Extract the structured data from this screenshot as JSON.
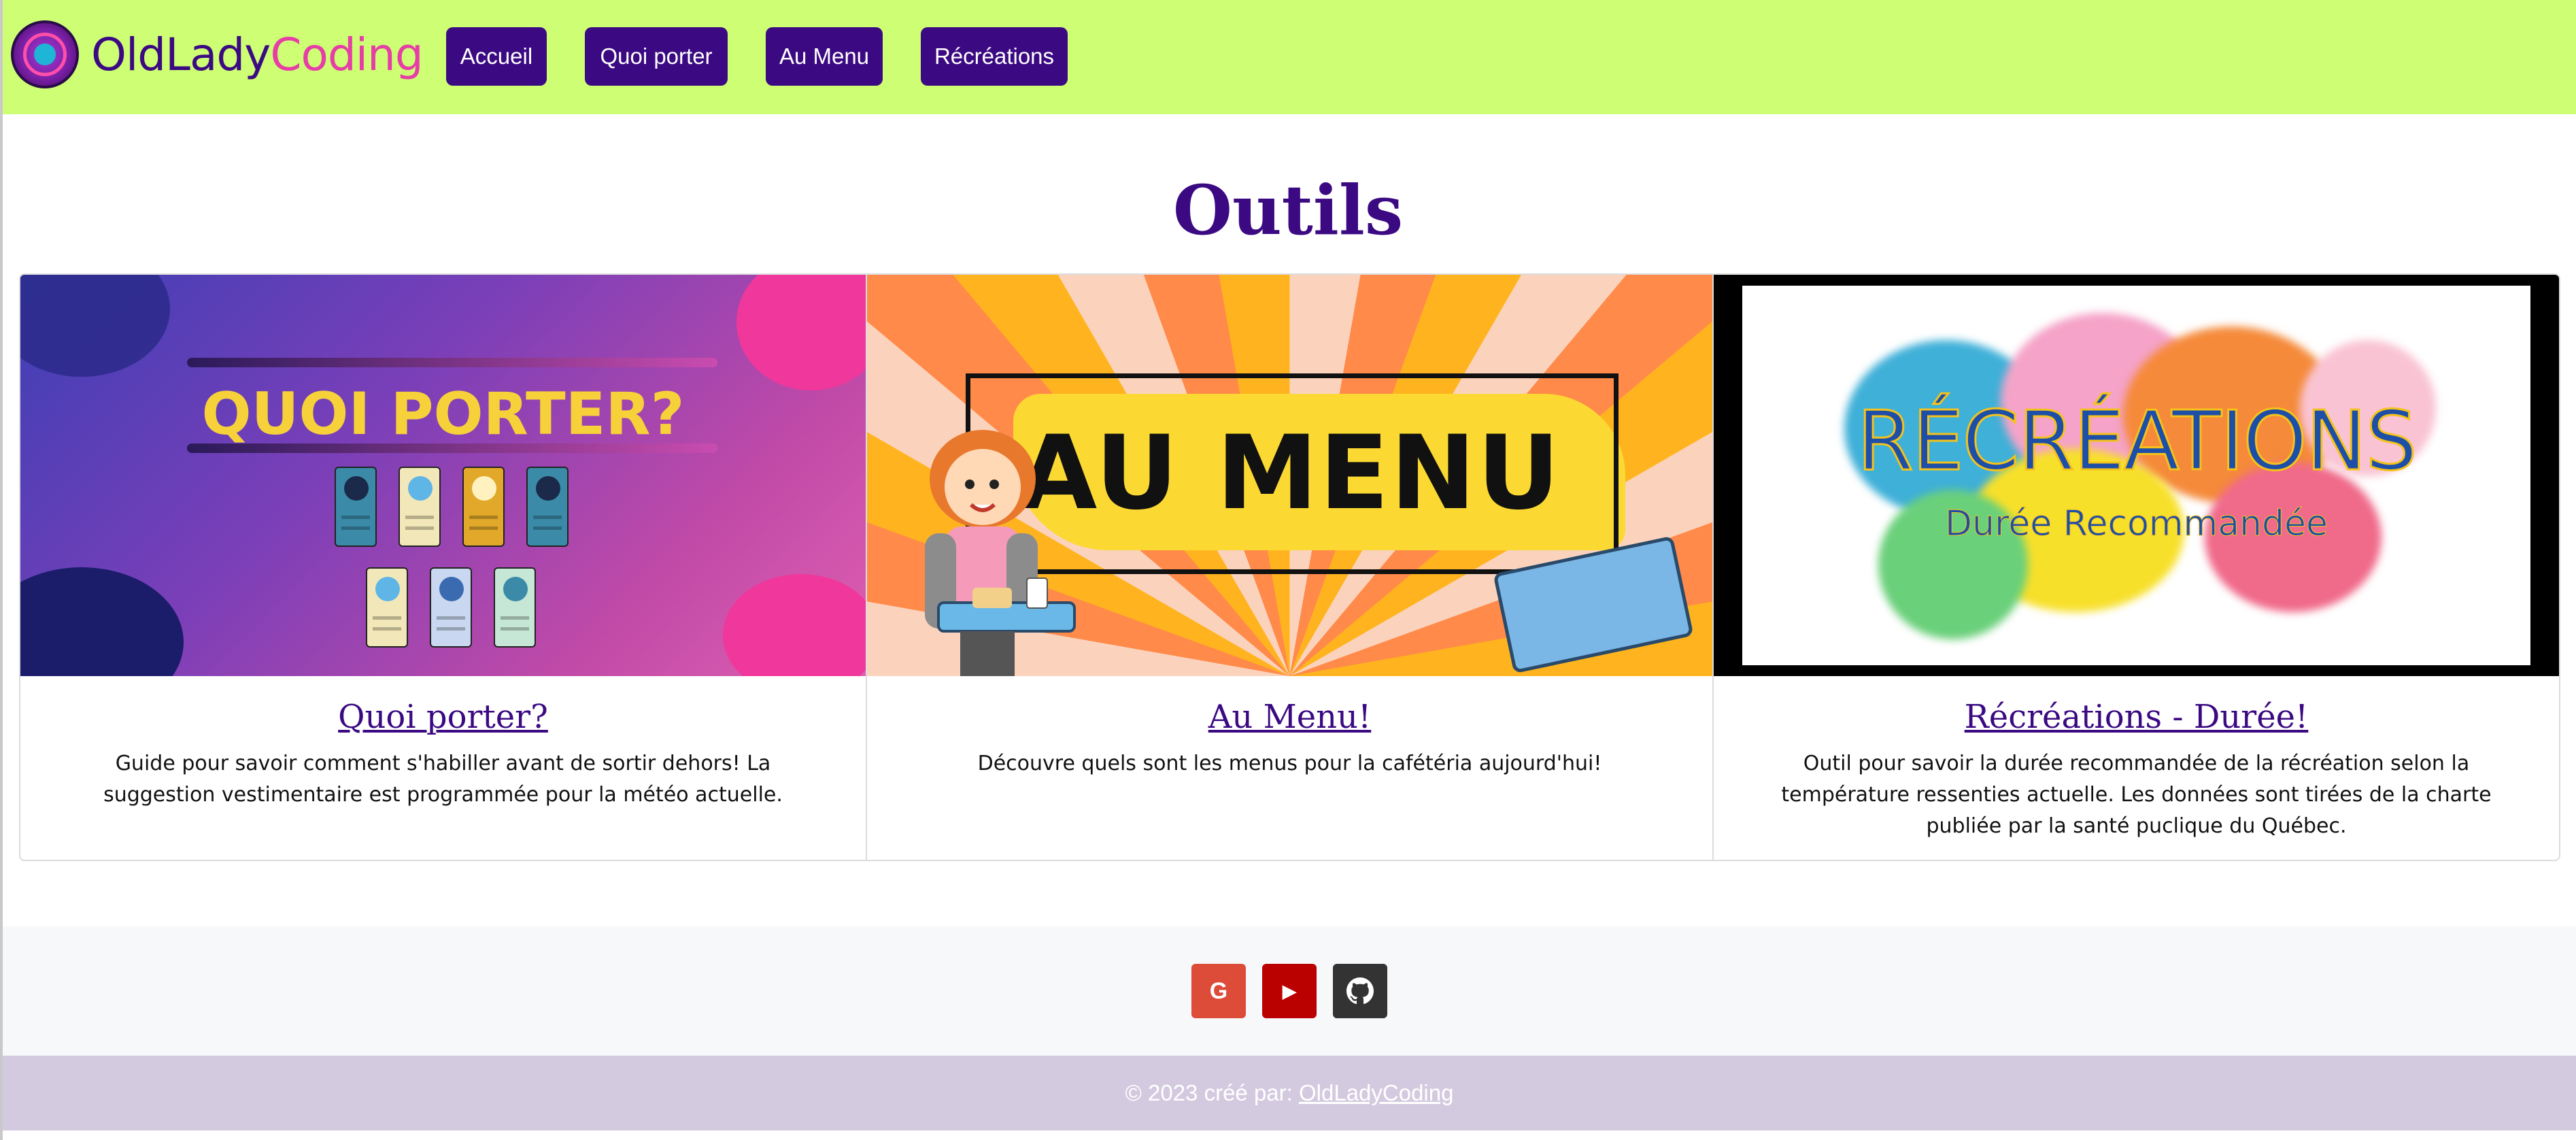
{
  "brand": {
    "part1": "OldLady",
    "part2": "Coding"
  },
  "nav": [
    {
      "label": "Accueil"
    },
    {
      "label": "Quoi porter"
    },
    {
      "label": "Au Menu"
    },
    {
      "label": "Récréations"
    }
  ],
  "page_title": "Outils",
  "cards": [
    {
      "image_text": "QUOI PORTER?",
      "title": "Quoi porter?",
      "text": "Guide pour savoir comment s'habiller avant de sortir dehors! La suggestion vestimentaire est programmée pour la météo actuelle."
    },
    {
      "image_text": "AU MENU",
      "title": "Au Menu!",
      "text": "Découvre quels sont les menus pour la cafétéria aujourd'hui!"
    },
    {
      "image_text": "RÉCRÉATIONS",
      "image_subtext": "Durée Recommandée",
      "title": "Récréations - Durée!",
      "text": "Outil pour savoir la durée recommandée de la récréation selon la température ressenties actuelle. Les données sont tirées de la charte publiée par la santé puclique du Québec."
    }
  ],
  "social": [
    {
      "icon": "google-icon",
      "glyph": "G",
      "color": "#dd4b39"
    },
    {
      "icon": "youtube-icon",
      "glyph": "▶",
      "color": "#bb0000"
    },
    {
      "icon": "github-icon",
      "glyph": "●",
      "color": "#333333"
    }
  ],
  "footer": {
    "copyright": "© 2023 créé par: ",
    "link": "OldLadyCoding"
  },
  "colors": {
    "nav_bg": "#cdfe74",
    "accent": "#3b0a82",
    "pink": "#e63ea6",
    "footer_bg": "#d4cae0"
  }
}
